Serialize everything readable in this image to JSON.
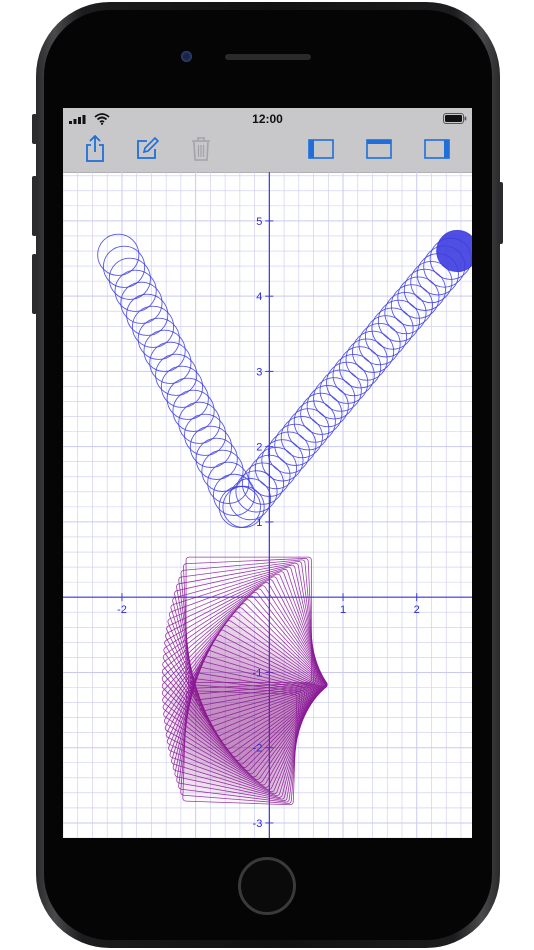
{
  "status_bar": {
    "time": "12:00"
  },
  "toolbar": {
    "items": [
      {
        "icon": "share-icon",
        "enabled": true
      },
      {
        "icon": "compose-icon",
        "enabled": true
      },
      {
        "icon": "trash-icon",
        "enabled": false
      },
      {
        "icon": "layout-left-icon",
        "enabled": true
      },
      {
        "icon": "layout-top-icon",
        "enabled": true
      },
      {
        "icon": "layout-right-icon",
        "enabled": true
      }
    ]
  },
  "colors": {
    "accent": "#1e6fd9",
    "axis": "#3a3adf",
    "grid": "#c9c9f2",
    "circles": "#3c3ce0",
    "squares": "#8a1a96"
  },
  "chart_data": {
    "type": "scatter",
    "xlim": [
      -2.8,
      2.75
    ],
    "ylim": [
      -3.2,
      5.65
    ],
    "grid": true,
    "x_ticks": [
      {
        "value": -2,
        "label": "-2"
      },
      {
        "value": 1,
        "label": "1"
      },
      {
        "value": 2,
        "label": "2"
      }
    ],
    "y_ticks": [
      {
        "value": 5,
        "label": "5"
      },
      {
        "value": 4,
        "label": "4"
      },
      {
        "value": 3,
        "label": "3"
      },
      {
        "value": 2,
        "label": "2"
      },
      {
        "value": 1,
        "label": "1"
      },
      {
        "value": -1,
        "label": "-1"
      },
      {
        "value": -2,
        "label": "-2"
      },
      {
        "value": -3,
        "label": "-3"
      }
    ],
    "series": [
      {
        "shape": "circle",
        "radius": 0.28,
        "path": [
          [
            -2.05,
            4.55
          ],
          [
            -0.4,
            1.2
          ],
          [
            -0.35,
            1.2
          ],
          [
            -0.35,
            1.2
          ],
          [
            2.55,
            4.6
          ]
        ],
        "count_first_leg": 22,
        "count_second_leg": 34,
        "filled_last": true
      },
      {
        "shape": "rotating-square",
        "count": 36,
        "start_center": [
          -0.28,
          -0.3
        ],
        "start_size": 1.7,
        "end_center": [
          -0.4,
          -2.0
        ],
        "end_size": 1.5,
        "start_angle": 0,
        "end_angle": 88,
        "fill_from_index": 18
      }
    ]
  }
}
